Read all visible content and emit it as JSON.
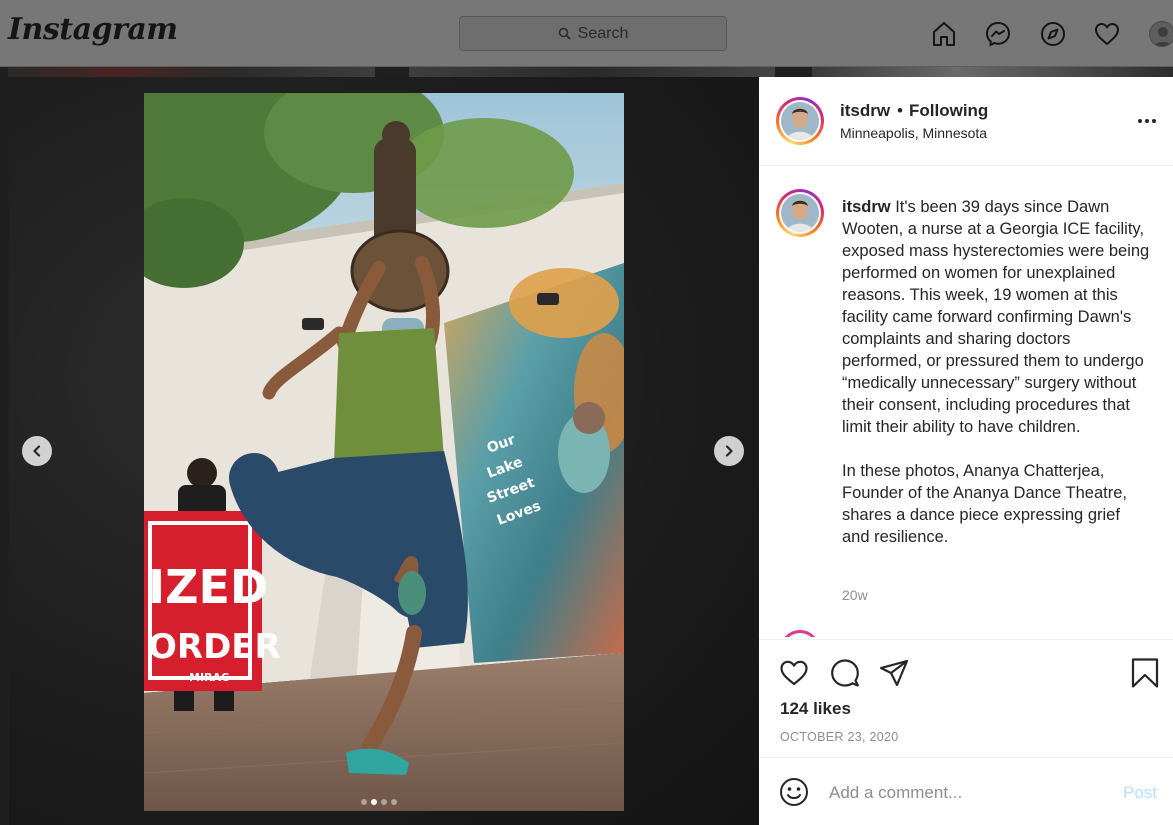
{
  "topnav": {
    "logo": "Instagram",
    "search_placeholder": "Search",
    "icons": [
      "home-icon",
      "messenger-icon",
      "explore-icon",
      "activity-heart-icon",
      "profile-avatar"
    ]
  },
  "post": {
    "username": "itsdrw",
    "follow_separator": "•",
    "follow_status": "Following",
    "location": "Minneapolis, Minnesota",
    "caption_username": "itsdrw",
    "caption_p1": "It's been 39 days since Dawn Wooten, a nurse at a Georgia ICE facility, exposed mass hysterectomies were being performed on women for unexplained reasons. This week, 19 women at this facility came forward confirming Dawn's complaints and sharing doctors performed, or pressured them to undergo “medically unnecessary” surgery without their consent, including procedures that limit their ability to have children.",
    "caption_p2": "In these photos, Ananya Chatterjea, Founder of the Ananya Dance Theatre, shares a dance piece expressing grief and resilience.",
    "age": "20w",
    "likes": "124 likes",
    "date": "OCTOBER 23, 2020",
    "carousel": {
      "total": 4,
      "active": 1
    },
    "photo_sign_lines": [
      "IZED",
      "ORDER",
      "MIRAC"
    ]
  },
  "comment": {
    "placeholder": "Add a comment...",
    "post_label": "Post"
  },
  "colors": {
    "accent_blue_disabled": "#b2dffc",
    "muted_text": "#8e8e8e",
    "story_ring": [
      "#feda75",
      "#fa7e1e",
      "#d62976",
      "#962fbf"
    ]
  }
}
